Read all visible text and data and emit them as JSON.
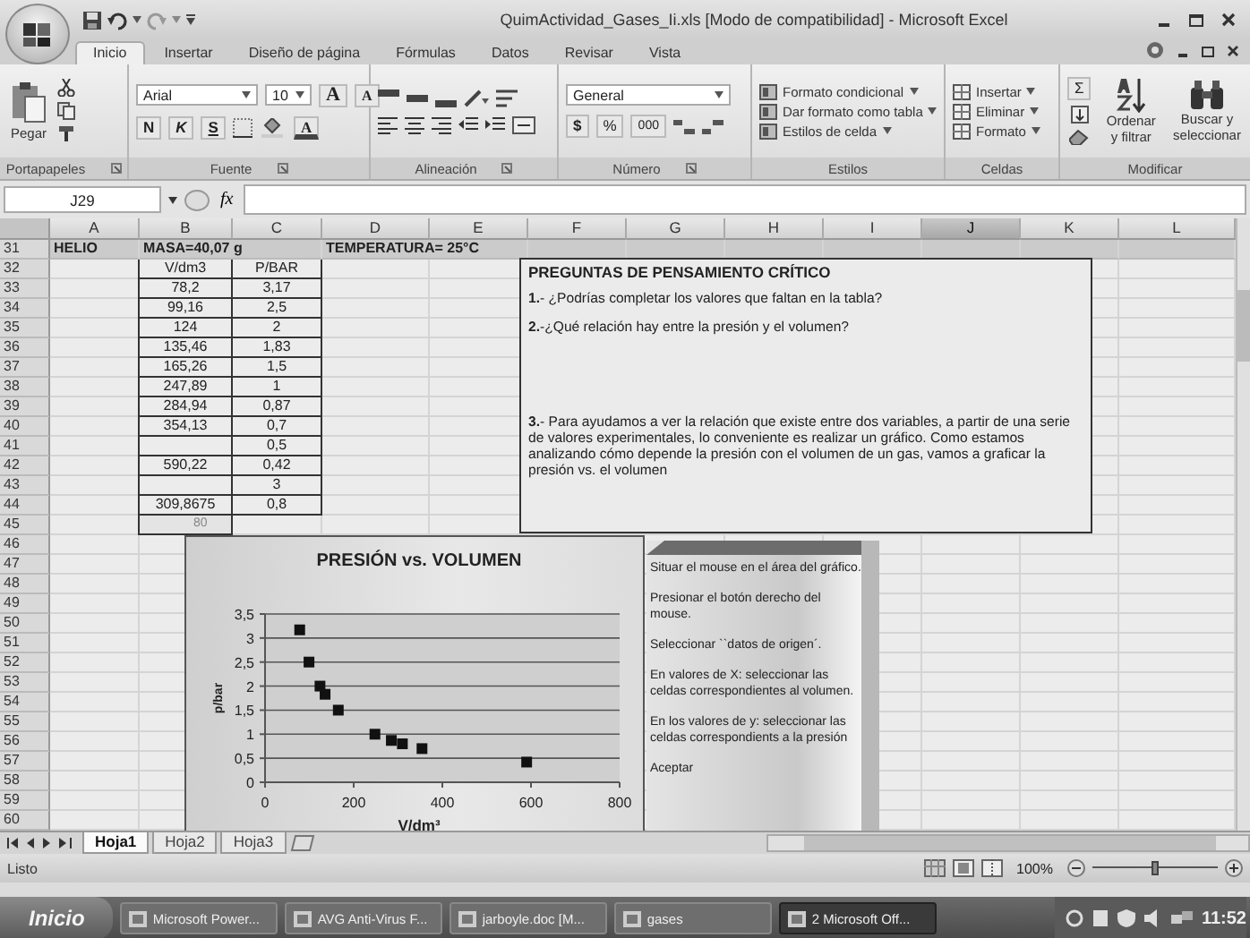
{
  "title_bar": {
    "title": "QuimActividad_Gases_Ii.xls  [Modo de compatibilidad] - Microsoft Excel"
  },
  "ribbon_tabs": [
    {
      "label": "Inicio",
      "selected": true
    },
    {
      "label": "Insertar",
      "selected": false
    },
    {
      "label": "Diseño de página",
      "selected": false
    },
    {
      "label": "Fórmulas",
      "selected": false
    },
    {
      "label": "Datos",
      "selected": false
    },
    {
      "label": "Revisar",
      "selected": false
    },
    {
      "label": "Vista",
      "selected": false
    }
  ],
  "ribbon": {
    "clipboard": {
      "label": "Portapapeles",
      "paste": "Pegar"
    },
    "font": {
      "label": "Fuente",
      "family": "Arial",
      "size": "10",
      "grow": "A",
      "shrink": "A",
      "bold": "N",
      "italic": "K",
      "underline": "S",
      "font_color": "A"
    },
    "alignment": {
      "label": "Alineación"
    },
    "number": {
      "label": "Número",
      "format": "General",
      "currency": "$",
      "percent": "%",
      "thousands": "000"
    },
    "styles": {
      "label": "Estilos",
      "buttons": [
        "Formato condicional",
        "Dar formato como tabla",
        "Estilos de celda"
      ]
    },
    "cells": {
      "label": "Celdas",
      "buttons": [
        "Insertar",
        "Eliminar",
        "Formato"
      ]
    },
    "editing": {
      "label": "Modificar",
      "sum": "Σ",
      "sort": "Ordenar y filtrar",
      "find": "Buscar y seleccionar"
    }
  },
  "formula_bar": {
    "name_box": "J29",
    "function": "fx"
  },
  "columns": [
    {
      "label": "A",
      "selected": false
    },
    {
      "label": "B",
      "selected": false
    },
    {
      "label": "C",
      "selected": false
    },
    {
      "label": "D",
      "selected": false
    },
    {
      "label": "E",
      "selected": false
    },
    {
      "label": "F",
      "selected": false
    },
    {
      "label": "G",
      "selected": false
    },
    {
      "label": "H",
      "selected": false
    },
    {
      "label": "I",
      "selected": false
    },
    {
      "label": "J",
      "selected": true
    },
    {
      "label": "K",
      "selected": false
    },
    {
      "label": "L",
      "selected": false
    }
  ],
  "row_numbers": [
    "31",
    "32",
    "33",
    "34",
    "35",
    "36",
    "37",
    "38",
    "39",
    "40",
    "41",
    "42",
    "43",
    "44",
    "45",
    "46",
    "47",
    "48",
    "49",
    "50",
    "51",
    "52",
    "53",
    "54",
    "55",
    "56",
    "57",
    "58",
    "59",
    "60"
  ],
  "sheet": {
    "element": "HELIO",
    "mass": "MASA=40,07 g",
    "temperature": "TEMPERATURA= 25°C",
    "table": {
      "columns": [
        "V/dm3",
        "P/BAR"
      ],
      "rows": [
        {
          "volume": "78,2",
          "pressure": "3,17"
        },
        {
          "volume": "99,16",
          "pressure": "2,5"
        },
        {
          "volume": "124",
          "pressure": "2"
        },
        {
          "volume": "135,46",
          "pressure": "1,83"
        },
        {
          "volume": "165,26",
          "pressure": "1,5"
        },
        {
          "volume": "247,89",
          "pressure": "1"
        },
        {
          "volume": "284,94",
          "pressure": "0,87"
        },
        {
          "volume": "354,13",
          "pressure": "0,7"
        },
        {
          "pressure": "0,5"
        },
        {
          "volume": "590,22",
          "pressure": "0,42"
        },
        {
          "pressure": "3"
        },
        {
          "volume": "309,8675",
          "pressure": "0,8"
        }
      ]
    },
    "pending_entry": "80"
  },
  "text_box": {
    "title": "PREGUNTAS DE PENSAMIENTO CRÍTICO",
    "paragraphs": [
      "**1.**- ¿Podrías completar los valores que faltan en la tabla?",
      "**2.**-¿Qué relación hay entre la presión y el volumen?",
      "**3.**- Para ayudamos a ver la relación que existe entre dos variables, a partir de una serie de valores experimentales, lo conveniente es realizar un gráfico. Como estamos analizando cómo depende la presión  con el volumen de un gas, vamos a graficar la presión vs. el volumen"
    ]
  },
  "chart": {
    "chart_data": {
      "type": "scatter",
      "grid": true,
      "title": "PRESIÓN vs. VOLUMEN",
      "xlabel": "V/dm³",
      "ylabel": "p/bar",
      "x": [
        78.2,
        99.16,
        124,
        135.46,
        165.26,
        247.89,
        284.94,
        354.13,
        590.22,
        309.8675
      ],
      "series": [
        {
          "color": "#111111",
          "values": [
            3.17,
            2.5,
            2,
            1.83,
            1.5,
            1,
            0.87,
            0.7,
            0.42,
            0.8
          ]
        }
      ],
      "xlim": [
        0,
        800
      ],
      "ylim": [
        0,
        3.5
      ],
      "xticks": [
        0,
        200,
        400,
        600,
        800
      ],
      "yticks": [
        0,
        {
          "value": 0.5,
          "label": "0,5"
        },
        1,
        {
          "value": 1.5,
          "label": "1,5"
        },
        2,
        {
          "value": 2.5,
          "label": "2,5"
        },
        3,
        {
          "value": 3.5,
          "label": "3,5"
        }
      ]
    }
  },
  "instructions": {
    "steps": [
      "Situar el mouse en el área del gráfico.",
      "Presionar el botón derecho del mouse.",
      "Seleccionar  ``datos de origen´.",
      "En valores de X: seleccionar las celdas correspondientes al volumen.",
      "En los valores de y: seleccionar las celdas correspondients a la presión",
      "Aceptar"
    ]
  },
  "sheet_tabs": [
    {
      "label": "Hoja1",
      "selected": true
    },
    {
      "label": "Hoja2",
      "selected": false
    },
    {
      "label": "Hoja3",
      "selected": false
    }
  ],
  "status_bar": {
    "status": "Listo",
    "zoom": "100%",
    "zoom_slider": {
      "level": 0.5
    }
  },
  "taskbar": {
    "start": "Inicio",
    "items": [
      {
        "label": "Microsoft Power...",
        "selected": false
      },
      {
        "label": "AVG Anti-Virus F...",
        "selected": false
      },
      {
        "label": "jarboyle.doc [M...",
        "selected": false
      },
      {
        "label": "gases",
        "selected": false
      },
      {
        "label": "2 Microsoft Off...",
        "selected": true
      }
    ],
    "clock": "11:52"
  }
}
